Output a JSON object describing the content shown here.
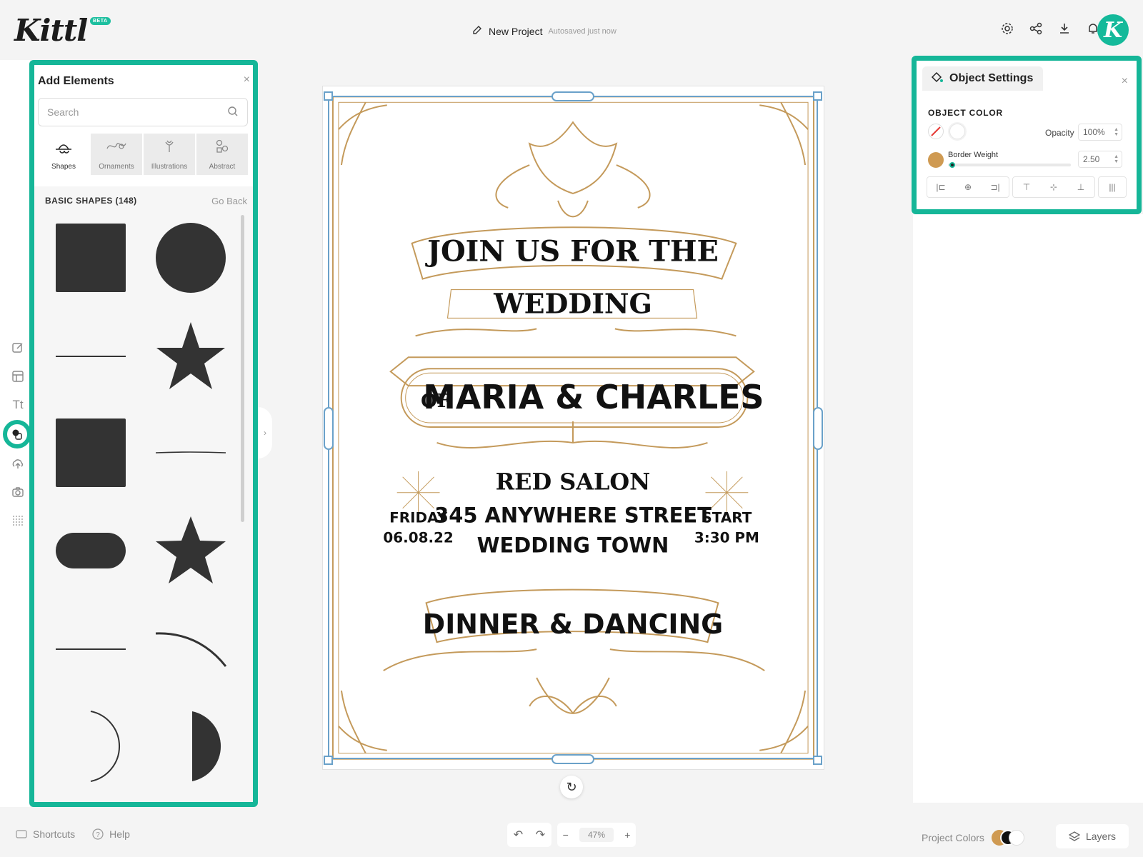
{
  "header": {
    "logo": "Kittl",
    "beta": "BETA",
    "project_name": "New Project",
    "autosave": "Autosaved just now",
    "avatar_letter": "K"
  },
  "add_elements": {
    "title": "Add Elements",
    "close": "×",
    "search_placeholder": "Search",
    "categories": [
      {
        "label": "Shapes",
        "icon": "shapes-icon",
        "active": true
      },
      {
        "label": "Ornaments",
        "icon": "ornaments-icon",
        "active": false
      },
      {
        "label": "Illustrations",
        "icon": "illustrations-icon",
        "active": false
      },
      {
        "label": "Abstract",
        "icon": "abstract-icon",
        "active": false
      }
    ],
    "section_title": "BASIC SHAPES (148)",
    "go_back": "Go Back",
    "shapes": [
      "square",
      "circle",
      "line",
      "star-5-point",
      "square",
      "thin-line",
      "pill",
      "star-5-point-wide",
      "line",
      "arc",
      "half-circle-outline",
      "half-circle-filled"
    ]
  },
  "canvas": {
    "line1": "JOIN US FOR THE",
    "line2": "WEDDING",
    "line3_of": "OF",
    "line3_names": "MARIA & CHARLES",
    "venue": "RED SALON",
    "street": "345 ANYWHERE STREET",
    "town": "WEDDING TOWN",
    "day": "FRIDAY",
    "date": "06.08.22",
    "start": "START",
    "time": "3:30 PM",
    "banner_bottom": "DINNER & DANCING",
    "ornament_color": "#c49a5b"
  },
  "object_settings": {
    "title": "Object Settings",
    "close": "×",
    "object_color": "OBJECT COLOR",
    "opacity_label": "Opacity",
    "opacity_value": "100%",
    "border_weight_label": "Border Weight",
    "border_weight_value": "2.50",
    "border_color": "#cf9a52",
    "border_weight_fraction": 0.03,
    "align_buttons": [
      "align-left",
      "align-center-h",
      "align-right",
      "align-top",
      "align-center-v",
      "align-bottom",
      "distribute"
    ]
  },
  "bottom": {
    "shortcuts": "Shortcuts",
    "help": "Help",
    "zoom": "47%",
    "zoom_minus": "−",
    "zoom_plus": "+",
    "project_colors": "Project Colors",
    "layers": "Layers"
  },
  "accent": "#15b698"
}
